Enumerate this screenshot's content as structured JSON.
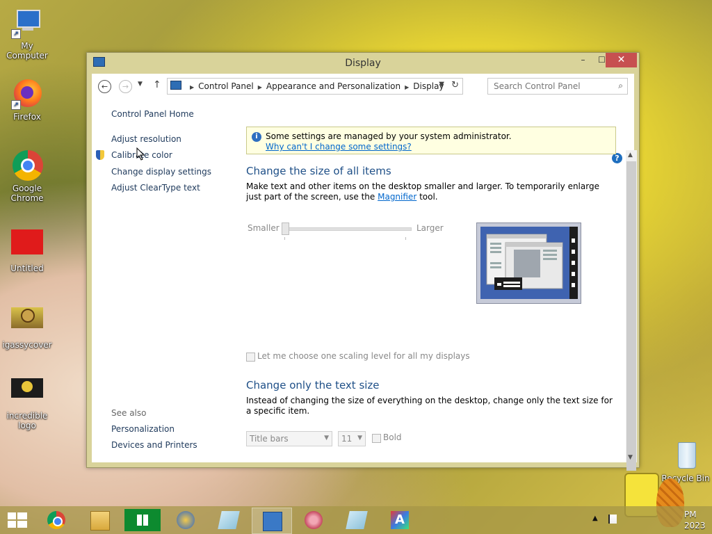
{
  "desktop": {
    "icons": [
      {
        "label": "My Computer"
      },
      {
        "label": "Firefox"
      },
      {
        "label": "Google Chrome"
      },
      {
        "label": "Untitled"
      },
      {
        "label": "igassycover"
      },
      {
        "label": "incredible logo"
      },
      {
        "label": "Recycle Bin"
      }
    ]
  },
  "window": {
    "title": "Display",
    "controls": {
      "minimize": "–",
      "maximize": "☐",
      "close": "✕"
    }
  },
  "address_bar": {
    "crumbs": [
      "Control Panel",
      "Appearance and Personalization",
      "Display"
    ],
    "search_placeholder": "Search Control Panel"
  },
  "left_pane": {
    "home": "Control Panel Home",
    "links": [
      "Adjust resolution",
      "Calibrate color",
      "Change display settings",
      "Adjust ClearType text"
    ],
    "see_also_title": "See also",
    "see_also": [
      "Personalization",
      "Devices and Printers"
    ]
  },
  "main": {
    "info": {
      "text": "Some settings are managed by your system administrator.",
      "link": "Why can't I change some settings?"
    },
    "section1": {
      "title": "Change the size of all items",
      "desc_before": "Make text and other items on the desktop smaller and larger. To temporarily enlarge just part of the screen, use the ",
      "desc_link": "Magnifier",
      "desc_after": " tool.",
      "slider_min_label": "Smaller",
      "slider_max_label": "Larger"
    },
    "scaling_checkbox_label": "Let me choose one scaling level for all my displays",
    "section2": {
      "title": "Change only the text size",
      "desc": "Instead of changing the size of everything on the desktop, change only the text size for a specific item.",
      "element_select": "Title bars",
      "size_select": "11",
      "bold_label": "Bold"
    }
  },
  "taskbar": {
    "clock_time": "PM",
    "clock_date": "2023"
  }
}
